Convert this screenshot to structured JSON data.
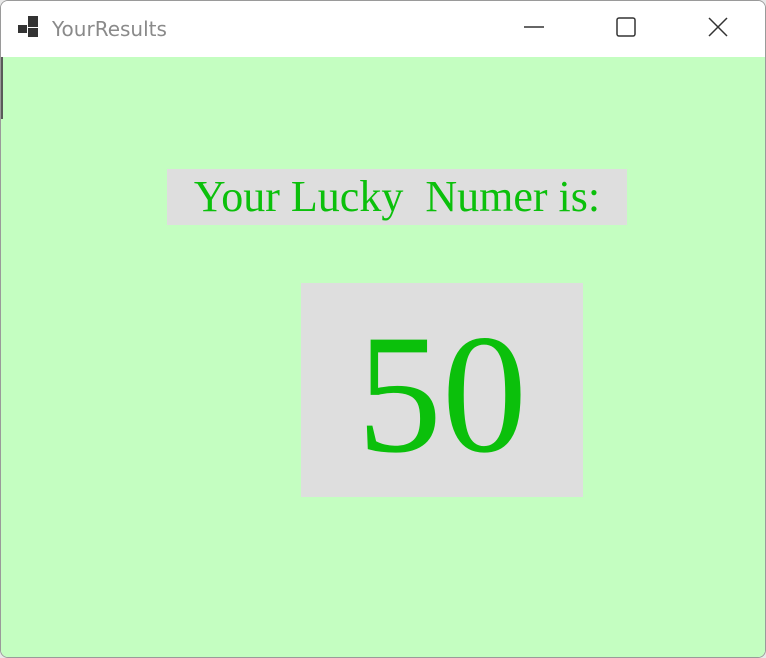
{
  "window": {
    "title": "YourResults",
    "icon": "app-window-icon",
    "controls": {
      "minimize_icon": "minimize-icon",
      "maximize_icon": "maximize-icon",
      "close_icon": "close-icon"
    }
  },
  "content": {
    "heading": "Your Lucky  Numer is:",
    "number": "50"
  },
  "colors": {
    "background": "#c4fec1",
    "text": "#0bc00b",
    "label_background": "#dedede"
  }
}
